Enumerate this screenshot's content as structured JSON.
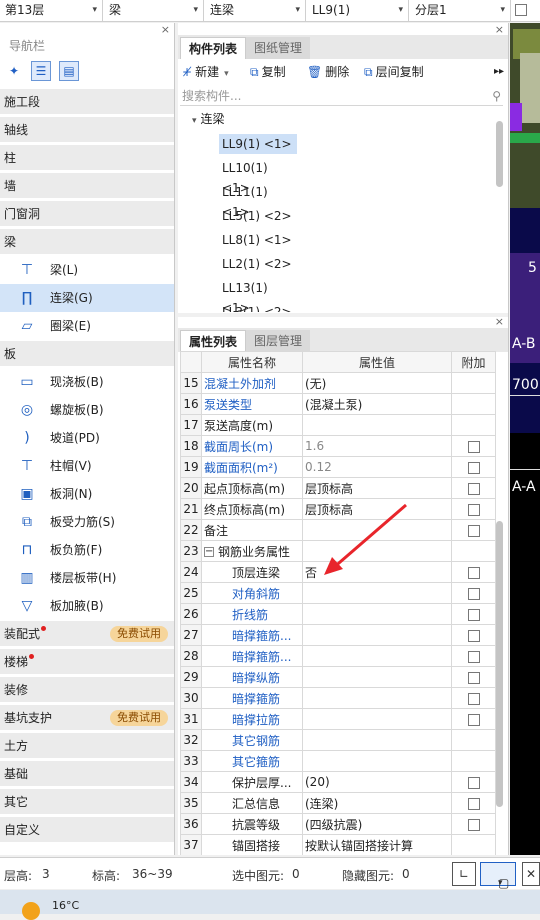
{
  "topbar": {
    "floor": "第13层",
    "component_type": "梁",
    "component_subtype": "连梁",
    "component_name": "LL9(1)",
    "layer": "分层1"
  },
  "left_panel": {
    "title": "导航栏",
    "close": "×",
    "categories": [
      {
        "label": "施工段"
      },
      {
        "label": "轴线"
      },
      {
        "label": "柱"
      },
      {
        "label": "墙"
      },
      {
        "label": "门窗洞"
      },
      {
        "label": "梁"
      },
      {
        "label": "板"
      },
      {
        "label": "装配式",
        "badge": "免费试用"
      },
      {
        "label": "楼梯"
      },
      {
        "label": "装修"
      },
      {
        "label": "基坑支护",
        "badge": "免费试用"
      },
      {
        "label": "土方"
      },
      {
        "label": "基础"
      },
      {
        "label": "其它"
      },
      {
        "label": "自定义"
      }
    ],
    "beam_items": [
      {
        "label": "梁(L)",
        "icon": "beam-icon"
      },
      {
        "label": "连梁(G)",
        "icon": "coupling-beam-icon"
      },
      {
        "label": "圈梁(E)",
        "icon": "ring-beam-icon"
      }
    ],
    "slab_items": [
      {
        "label": "现浇板(B)",
        "icon": "cast-slab-icon"
      },
      {
        "label": "螺旋板(B)",
        "icon": "spiral-slab-icon"
      },
      {
        "label": "坡道(PD)",
        "icon": "ramp-icon"
      },
      {
        "label": "柱帽(V)",
        "icon": "column-cap-icon"
      },
      {
        "label": "板洞(N)",
        "icon": "slab-hole-icon"
      },
      {
        "label": "板受力筋(S)",
        "icon": "slab-rebar-icon"
      },
      {
        "label": "板负筋(F)",
        "icon": "negative-rebar-icon"
      },
      {
        "label": "楼层板带(H)",
        "icon": "slab-strip-icon"
      },
      {
        "label": "板加腋(B)",
        "icon": "slab-haunch-icon"
      }
    ]
  },
  "component_panel": {
    "tabs": [
      "构件列表",
      "图纸管理"
    ],
    "toolbar": {
      "new": "新建",
      "copy": "复制",
      "delete": "删除",
      "interlayer_copy": "层间复制"
    },
    "search_placeholder": "搜索构件...",
    "tree_root": "连梁",
    "items": [
      "LL9(1) <1>",
      "LL10(1) <1>",
      "LL11(1) <1>",
      "LL5(1) <2>",
      "LL8(1) <1>",
      "LL2(1) <2>",
      "LL13(1) <1>",
      "LL3(1) <2>"
    ]
  },
  "property_panel": {
    "tabs": [
      "属性列表",
      "图层管理"
    ],
    "headers": [
      "属性名称",
      "属性值",
      "附加"
    ],
    "rows": [
      {
        "num": "15",
        "name": "混凝土外加剂",
        "value": "(无)",
        "blue": true,
        "check": false
      },
      {
        "num": "16",
        "name": "泵送类型",
        "value": "(混凝土泵)",
        "blue": true,
        "check": false
      },
      {
        "num": "17",
        "name": "泵送高度(m)",
        "value": "",
        "check": false
      },
      {
        "num": "18",
        "name": "截面周长(m)",
        "value": "1.6",
        "blue": true,
        "grey": true,
        "check": true
      },
      {
        "num": "19",
        "name": "截面面积(m²)",
        "value": "0.12",
        "blue": true,
        "grey": true,
        "check": true
      },
      {
        "num": "20",
        "name": "起点顶标高(m)",
        "value": "层顶标高",
        "check": true
      },
      {
        "num": "21",
        "name": "终点顶标高(m)",
        "value": "层顶标高",
        "check": true
      },
      {
        "num": "22",
        "name": "备注",
        "value": "",
        "check": true
      },
      {
        "num": "23",
        "name": "钢筋业务属性",
        "value": "",
        "group": true
      },
      {
        "num": "24",
        "name": "顶层连梁",
        "value": "否",
        "indent": true,
        "check": true
      },
      {
        "num": "25",
        "name": "对角斜筋",
        "value": "",
        "indent": true,
        "blue": true,
        "check": true
      },
      {
        "num": "26",
        "name": "折线筋",
        "value": "",
        "indent": true,
        "blue": true,
        "check": true
      },
      {
        "num": "27",
        "name": "暗撑箍筋...",
        "value": "",
        "indent": true,
        "blue": true,
        "check": true
      },
      {
        "num": "28",
        "name": "暗撑箍筋...",
        "value": "",
        "indent": true,
        "blue": true,
        "check": true
      },
      {
        "num": "29",
        "name": "暗撑纵筋",
        "value": "",
        "indent": true,
        "blue": true,
        "check": true
      },
      {
        "num": "30",
        "name": "暗撑箍筋",
        "value": "",
        "indent": true,
        "blue": true,
        "check": true
      },
      {
        "num": "31",
        "name": "暗撑拉筋",
        "value": "",
        "indent": true,
        "blue": true,
        "check": true
      },
      {
        "num": "32",
        "name": "其它钢筋",
        "value": "",
        "indent": true,
        "blue": true,
        "check": false
      },
      {
        "num": "33",
        "name": "其它箍筋",
        "value": "",
        "indent": true,
        "blue": true,
        "check": false
      },
      {
        "num": "34",
        "name": "保护层厚...",
        "value": "(20)",
        "indent": true,
        "check": true
      },
      {
        "num": "35",
        "name": "汇总信息",
        "value": "(连梁)",
        "indent": true,
        "check": true
      },
      {
        "num": "36",
        "name": "抗震等级",
        "value": "(四级抗震)",
        "indent": true,
        "check": true
      },
      {
        "num": "37",
        "name": "锚固搭接",
        "value": "按默认锚固搭接计算",
        "indent": true,
        "check": false
      }
    ]
  },
  "viewport_labels": [
    "5",
    "A-B",
    "700",
    "A-A"
  ],
  "status_bar": {
    "floor_height_label": "层高:",
    "floor_height": "3",
    "elevation_label": "标高:",
    "elevation": "36~39",
    "selected_label": "选中图元:",
    "selected": "0",
    "hidden_label": "隐藏图元:",
    "hidden": "0"
  },
  "taskbar": {
    "temperature": "16°C"
  },
  "colors": {
    "accent": "#2160c4",
    "selection": "#cde0f7",
    "annotation_arrow": "#e8252b",
    "badge": "#f6d59a"
  }
}
